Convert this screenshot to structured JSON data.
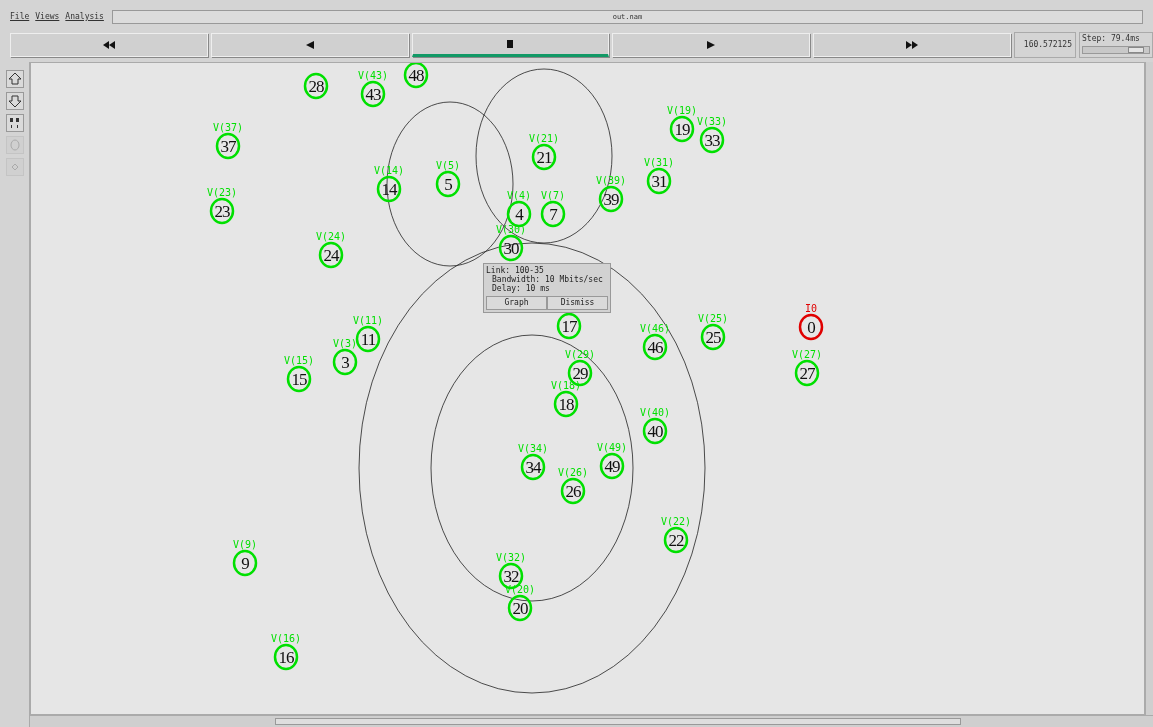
{
  "menu": [
    "File",
    "Views",
    "Analysis"
  ],
  "window": {
    "title": "out.nam"
  },
  "controls": [
    {
      "kind": "rewind",
      "selected": false
    },
    {
      "kind": "back",
      "selected": false
    },
    {
      "kind": "stop",
      "selected": true
    },
    {
      "kind": "play",
      "selected": false
    },
    {
      "kind": "forward",
      "selected": false
    }
  ],
  "time": "160.572125",
  "step": {
    "label": "Step: 79.4ms",
    "level": 0.8
  },
  "tools": [
    {
      "kind": "zoom_in",
      "disabled": false
    },
    {
      "kind": "zoom_out",
      "disabled": false
    },
    {
      "kind": "edit",
      "disabled": false
    },
    {
      "kind": "circle",
      "disabled": true
    },
    {
      "kind": "diamond",
      "disabled": true
    }
  ],
  "nodes": [
    {
      "number": "28",
      "color": "#00e000"
    },
    {
      "number": "43",
      "label": "V(43)",
      "color": "#00e000"
    },
    {
      "number": "48",
      "color": "#00e000"
    },
    {
      "number": "37",
      "label": "V(37)",
      "color": "#00e000"
    },
    {
      "number": "23",
      "label": "V(23)",
      "color": "#00e000"
    },
    {
      "number": "19",
      "label": "V(19)",
      "color": "#00e000"
    },
    {
      "number": "33",
      "label": "V(33)",
      "color": "#00e000"
    },
    {
      "number": "21",
      "label": "V(21)",
      "color": "#00e000"
    },
    {
      "number": "14",
      "label": "V(14)",
      "color": "#00e000"
    },
    {
      "number": "5",
      "label": "V(5)",
      "color": "#00e000"
    },
    {
      "number": "31",
      "label": "V(31)",
      "color": "#00e000"
    },
    {
      "number": "39",
      "label": "V(39)",
      "color": "#00e000"
    },
    {
      "number": "4",
      "label": "V(4)",
      "color": "#00e000"
    },
    {
      "number": "7",
      "label": "V(7)",
      "color": "#00e000"
    },
    {
      "number": "24",
      "label": "V(24)",
      "color": "#00e000"
    },
    {
      "number": "30",
      "label": "V(30)",
      "color": "#00e000"
    },
    {
      "number": "11",
      "label": "V(11)",
      "color": "#00e000"
    },
    {
      "number": "17",
      "color": "#00e000"
    },
    {
      "number": "3",
      "label": "V(3)",
      "color": "#00e000"
    },
    {
      "number": "15",
      "label": "V(15)",
      "color": "#00e000"
    },
    {
      "number": "46",
      "label": "V(46)",
      "color": "#00e000"
    },
    {
      "number": "25",
      "label": "V(25)",
      "color": "#00e000"
    },
    {
      "number": "0",
      "label": "I0",
      "color": "#e00000"
    },
    {
      "number": "29",
      "label": "V(29)",
      "color": "#00e000"
    },
    {
      "number": "27",
      "label": "V(27)",
      "color": "#00e000"
    },
    {
      "number": "18",
      "label": "V(18)",
      "color": "#00e000"
    },
    {
      "number": "40",
      "label": "V(40)",
      "color": "#00e000"
    },
    {
      "number": "34",
      "label": "V(34)",
      "color": "#00e000"
    },
    {
      "number": "49",
      "label": "V(49)",
      "color": "#00e000"
    },
    {
      "number": "26",
      "label": "V(26)",
      "color": "#00e000"
    },
    {
      "number": "22",
      "label": "V(22)",
      "color": "#00e000"
    },
    {
      "number": "9",
      "label": "V(9)",
      "color": "#00e000"
    },
    {
      "number": "32",
      "label": "V(32)",
      "color": "#00e000"
    },
    {
      "number": "20",
      "label": "V(20)",
      "color": "#00e000"
    },
    {
      "number": "16",
      "label": "V(16)",
      "color": "#00e000"
    }
  ],
  "popup": {
    "lines": [
      "Link: 100-35",
      "Bandwidth: 10 Mbits/sec",
      "Delay: 10 ms"
    ],
    "buttons": [
      "Graph",
      "Dismiss"
    ]
  }
}
